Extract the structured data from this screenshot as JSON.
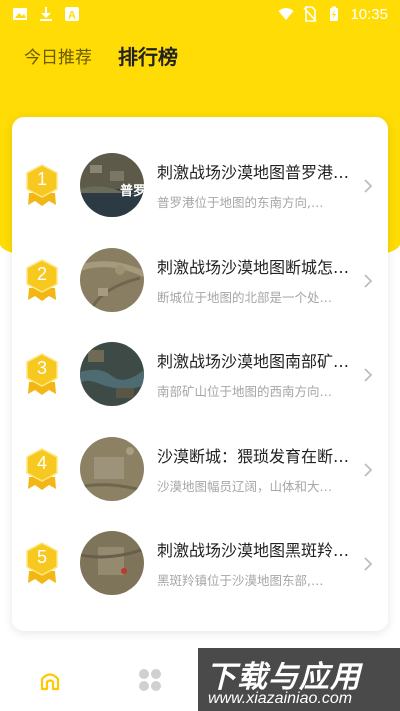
{
  "status_bar": {
    "time": "10:35"
  },
  "tabs": [
    {
      "label": "今日推荐",
      "active": false
    },
    {
      "label": "排行榜",
      "active": true
    }
  ],
  "list": [
    {
      "rank": "1",
      "title": "刺激战场沙漠地图普罗港…",
      "desc": "普罗港位于地图的东南方向,…"
    },
    {
      "rank": "2",
      "title": "刺激战场沙漠地图断城怎…",
      "desc": "断城位于地图的北部是一个处…"
    },
    {
      "rank": "3",
      "title": "刺激战场沙漠地图南部矿…",
      "desc": "南部矿山位于地图的西南方向…"
    },
    {
      "rank": "4",
      "title": "沙漠断城：猥琐发育在断…",
      "desc": "沙漠地图幅员辽阔，山体和大…"
    },
    {
      "rank": "5",
      "title": "刺激战场沙漠地图黑斑羚…",
      "desc": "黑斑羚镇位于沙漠地图东部,…"
    }
  ],
  "bottom_nav": [
    {
      "icon": "home-icon",
      "active": true
    },
    {
      "icon": "apps-icon",
      "active": false
    }
  ],
  "watermark": {
    "main": "下载与应用",
    "sub": "www.xiazainiao.com"
  },
  "colors": {
    "accent": "#FFDC05",
    "badge": "#F7C81F"
  }
}
